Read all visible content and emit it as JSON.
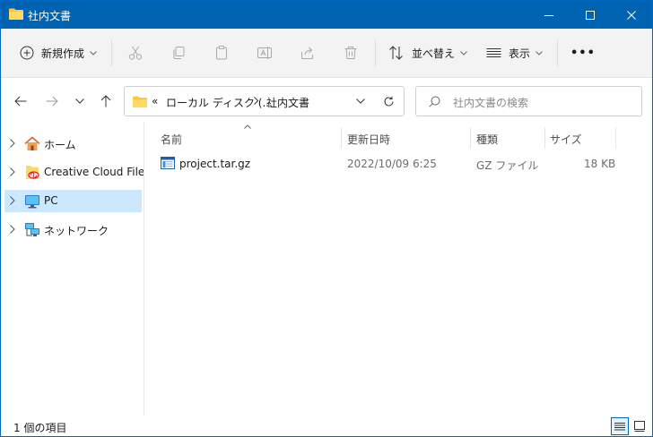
{
  "window": {
    "title": "社内文書",
    "icon": "folder-icon"
  },
  "commandbar": {
    "new_label": "新規作成",
    "sort_label": "並べ替え",
    "view_label": "表示",
    "more_label": "•••",
    "icons": [
      "cut-icon",
      "copy-icon",
      "paste-icon",
      "rename-icon",
      "share-icon",
      "delete-icon"
    ]
  },
  "address": {
    "overflow": "«",
    "crumbs": [
      "ローカル ディスク (...",
      "社内文書"
    ]
  },
  "search": {
    "placeholder": "社内文書の検索"
  },
  "sidebar": {
    "items": [
      {
        "label": "ホーム",
        "icon": "home-icon"
      },
      {
        "label": "Creative Cloud Files",
        "icon": "creative-cloud-icon"
      },
      {
        "label": "PC",
        "icon": "pc-icon",
        "selected": true
      },
      {
        "label": "ネットワーク",
        "icon": "network-icon"
      }
    ]
  },
  "table": {
    "columns": [
      "名前",
      "更新日時",
      "種類",
      "サイズ"
    ],
    "rows": [
      {
        "name": "project.tar.gz",
        "modified": "2022/10/09 6:25",
        "type": "GZ ファイル",
        "size": "18 KB"
      }
    ]
  },
  "status": {
    "count": "1 個の項目"
  },
  "colors": {
    "titlebar": "#0063b1",
    "selection": "#cce8ff",
    "accent": "#0067c0"
  }
}
